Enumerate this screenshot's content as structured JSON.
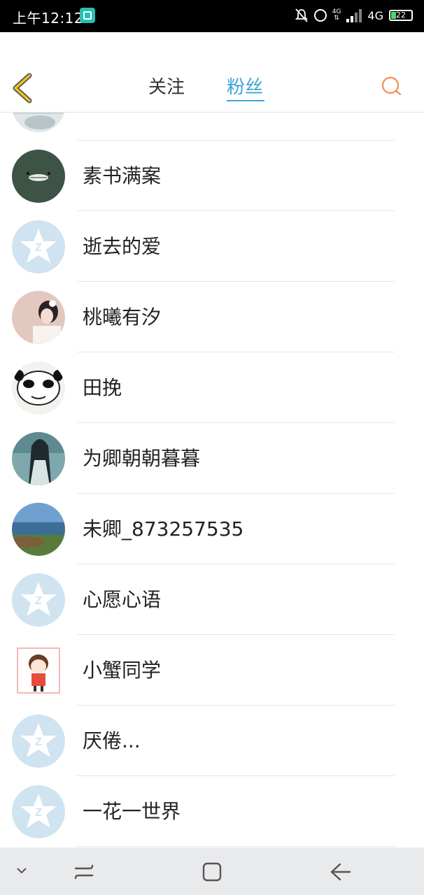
{
  "status_bar": {
    "time": "上午12:12",
    "network_small": "4G",
    "network": "4G",
    "battery": "22"
  },
  "header": {
    "tabs": [
      {
        "label": "关注"
      },
      {
        "label": "粉丝"
      }
    ],
    "active_tab": "粉丝"
  },
  "icons": {
    "back": "chevron-left-icon",
    "search": "search-icon",
    "nav": [
      "chevron-down-icon",
      "recent-apps-icon",
      "home-icon",
      "back-arrow-icon"
    ]
  },
  "colors": {
    "accent": "#3aa5dc",
    "back_icon": "#f0c020",
    "search_icon": "#f09050",
    "default_avatar_bg": "#cfe3f0"
  },
  "fans": [
    {
      "name": "",
      "avatar": "photo-partial"
    },
    {
      "name": "素书满案",
      "avatar": "totoro"
    },
    {
      "name": "逝去的爱",
      "avatar": "default"
    },
    {
      "name": "桃曦有汐",
      "avatar": "girl-photo"
    },
    {
      "name": "田挽",
      "avatar": "panda-meme"
    },
    {
      "name": "为卿朝朝暮暮",
      "avatar": "ancient-man"
    },
    {
      "name": "未卿_873257535",
      "avatar": "seaside"
    },
    {
      "name": "心愿心语",
      "avatar": "default"
    },
    {
      "name": "小蟹同学",
      "avatar": "cartoon-boy"
    },
    {
      "name": "厌倦...",
      "avatar": "default"
    },
    {
      "name": "一花一世界",
      "avatar": "default"
    }
  ]
}
